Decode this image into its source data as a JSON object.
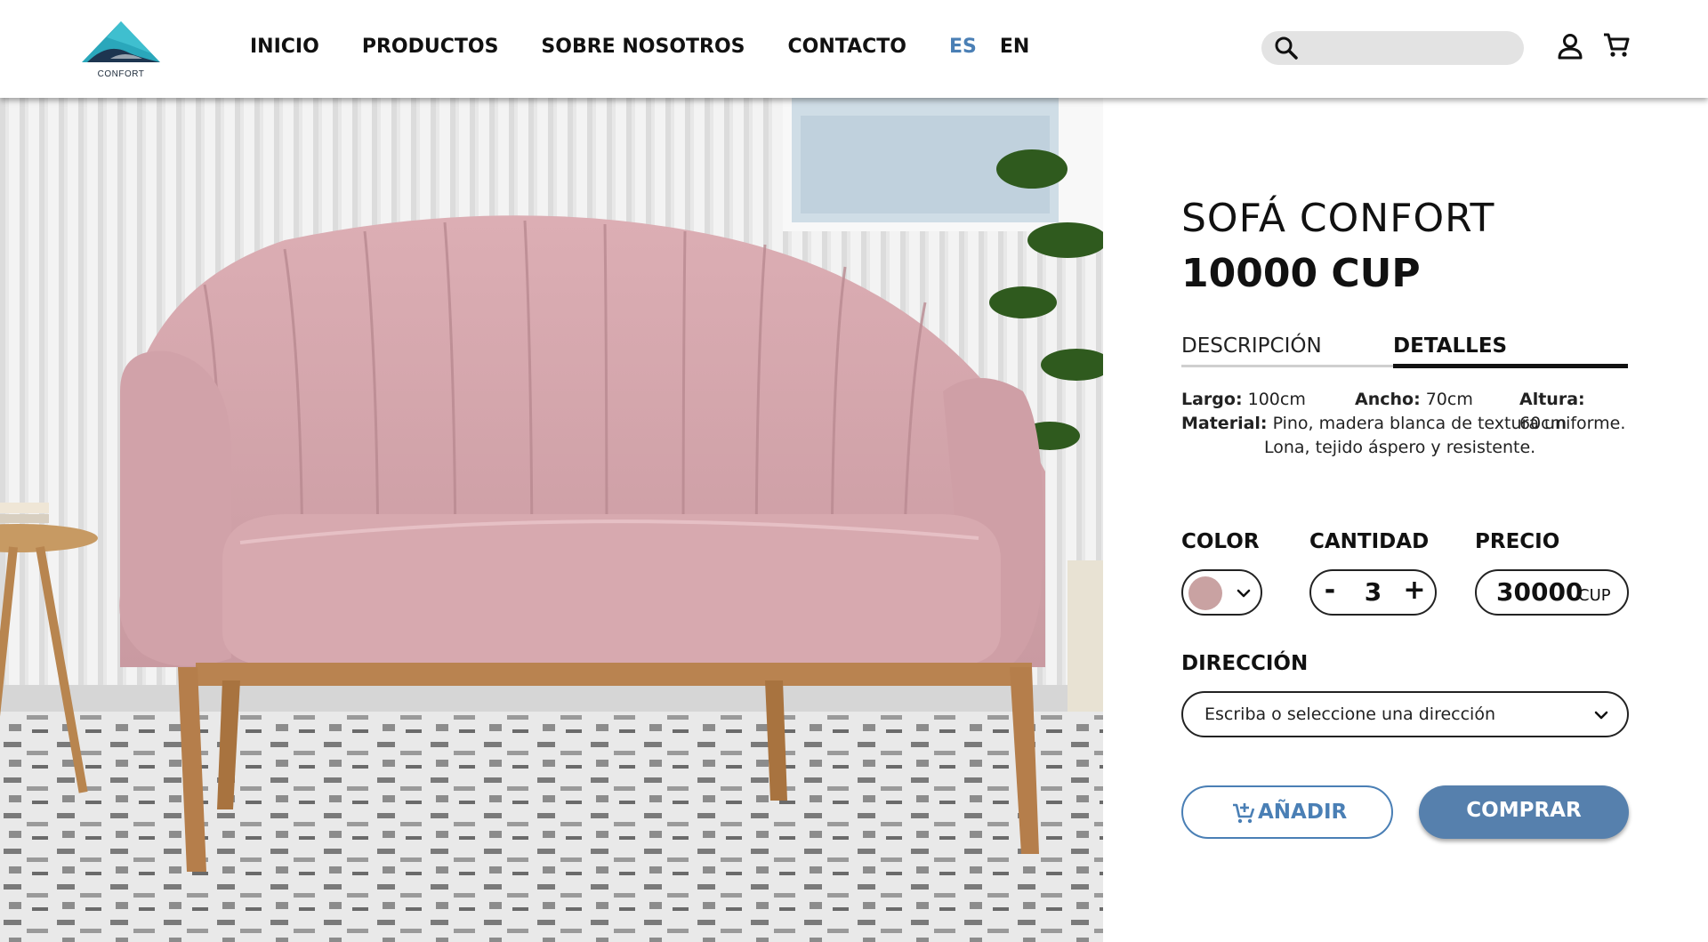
{
  "header": {
    "logo_text": "CONFORT",
    "nav": [
      "INICIO",
      "PRODUCTOS",
      "SOBRE NOSOTROS",
      "CONTACTO"
    ],
    "languages": {
      "active": "ES",
      "other": "EN"
    },
    "search": {
      "placeholder": ""
    },
    "icons": [
      "search-icon",
      "user-icon",
      "cart-icon"
    ],
    "accent_color": "#4a7fb5"
  },
  "hero": {
    "alt": "sofa-photo"
  },
  "product": {
    "title": "SOFÁ CONFORT",
    "price": "10000 CUP",
    "tabs": [
      "DESCRIPCIÓN",
      "DETALLES"
    ],
    "active_tab": "DETALLES",
    "details": {
      "largo_label": "Largo:",
      "largo_value": "100cm",
      "ancho_label": "Ancho:",
      "ancho_value": "70cm",
      "altura_label": "Altura:",
      "altura_value": "60cm",
      "material_label": "Material:",
      "material_line1": "Pino, madera blanca de textura uniforme.",
      "material_line2": "Lona, tejido áspero y resistente."
    },
    "color_label": "COLOR",
    "color_value": "#c9a2a2",
    "quantity_label": "CANTIDAD",
    "quantity_minus": "-",
    "quantity_value": "3",
    "quantity_plus": "+",
    "total_label": "PRECIO",
    "total_value": "30000",
    "total_currency": "CUP",
    "address_label": "DIRECCIÓN",
    "address_placeholder": "Escriba o seleccione una dirección",
    "add_button": "AÑADIR",
    "buy_button": "COMPRAR",
    "buy_color": "#5680ad"
  }
}
